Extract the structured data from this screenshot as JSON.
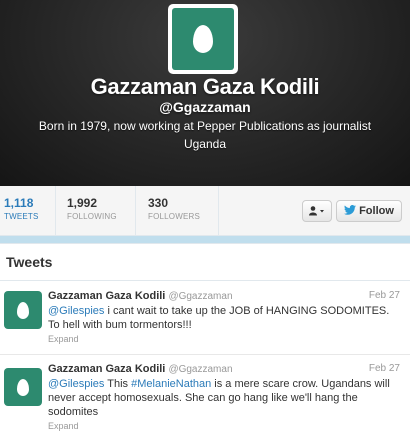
{
  "profile": {
    "name": "Gazzaman Gaza Kodili",
    "handle": "@Ggazzaman",
    "bio": "Born in 1979, now working at Pepper Publications as journalist",
    "location": "Uganda"
  },
  "stats": [
    {
      "value": "1,118",
      "label": "TWEETS"
    },
    {
      "value": "1,992",
      "label": "FOLLOWING"
    },
    {
      "value": "330",
      "label": "FOLLOWERS"
    }
  ],
  "actions": {
    "dropdown_icon": "user-icon",
    "follow_label": "Follow"
  },
  "tweets_heading": "Tweets",
  "tweets": [
    {
      "author": "Gazzaman Gaza Kodili",
      "handle": "@Ggazzaman",
      "date": "Feb 27",
      "mention": "@Gilespies",
      "text": " i cant wait to take up the JOB of HANGING SODOMITES. To hell with bum tormentors!!!",
      "expand": "Expand"
    },
    {
      "author": "Gazzaman Gaza Kodili",
      "handle": "@Ggazzaman",
      "date": "Feb 27",
      "mention": "@Gilespies",
      "text_pre": " This ",
      "hashtag": "#MelanieNathan",
      "text_post": " is a mere scare crow. Ugandans will never accept homosexuals. She can go hang like we'll hang the sodomites",
      "expand": "Expand"
    }
  ],
  "colors": {
    "accent": "#2b7bb9",
    "avatar_bg": "#2d8a6f",
    "page_bg": "#c0deed"
  }
}
